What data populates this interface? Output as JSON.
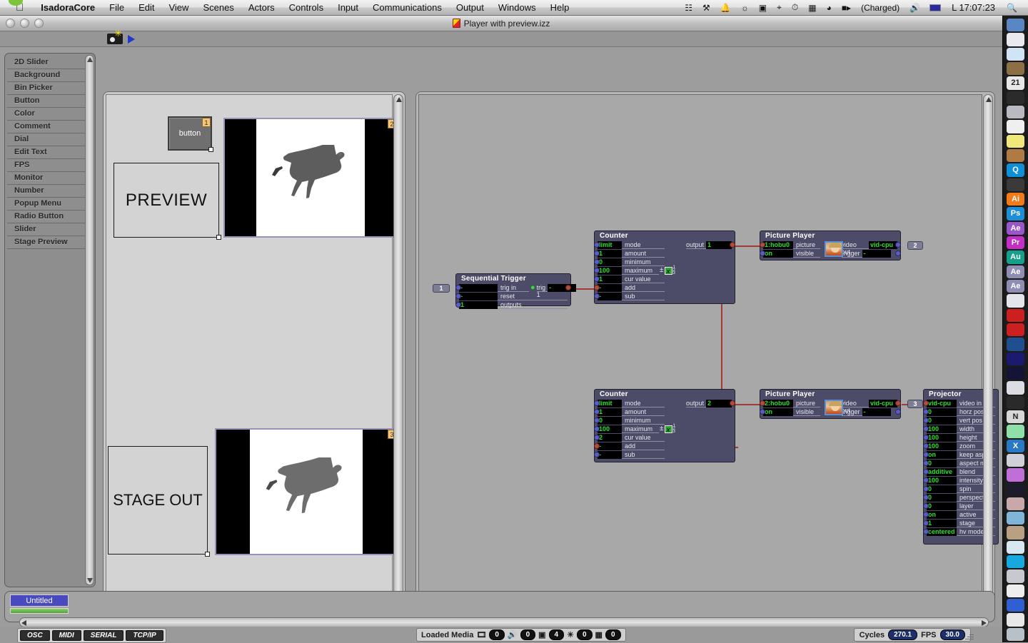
{
  "menubar": {
    "app_name": "IsadoraCore",
    "items": [
      "File",
      "Edit",
      "View",
      "Scenes",
      "Actors",
      "Controls",
      "Input",
      "Communications",
      "Output",
      "Windows",
      "Help"
    ],
    "status_icons": [
      "grid-icon",
      "ink-icon",
      "bell-icon",
      "keyboard-brightness-icon",
      "display-icon",
      "bluetooth-icon",
      "timemachine-icon",
      "screensharing-icon",
      "wifi-icon"
    ],
    "battery_label": "(Charged)",
    "volume_icon": "speaker-icon",
    "input_flag": "keyboard-flag",
    "clock": "L 17:07:23",
    "search_icon": "search-icon"
  },
  "window": {
    "title": "Player with preview.izz",
    "doc_icon": "izz-document-icon",
    "toolbar": {
      "snapshot_icon": "camera-snapshot-icon",
      "run_icon": "play-triangle-icon"
    }
  },
  "tool_list": {
    "items": [
      "2D Slider",
      "Background",
      "Bin Picker",
      "Button",
      "Color",
      "Comment",
      "Dial",
      "Edit Text",
      "FPS",
      "Monitor",
      "Number",
      "Popup Menu",
      "Radio Button",
      "Slider",
      "Stage Preview"
    ]
  },
  "control_panel": {
    "button_widget": {
      "label": "button",
      "index": "1"
    },
    "preview_text": "PREVIEW",
    "stage_out_text": "STAGE OUT",
    "preview_stage": {
      "index": "2"
    },
    "output_stage": {
      "index": "3"
    }
  },
  "scene_editor": {
    "actors": [
      {
        "name": "Sequential Trigger",
        "input_badge": "1",
        "inputs": [
          {
            "value": "-",
            "label": "trig in"
          },
          {
            "value": "-",
            "label": "reset"
          },
          {
            "value": "1",
            "label": "outputs"
          }
        ],
        "outputs": [
          {
            "label": "trig 1",
            "value": "-",
            "led": "green-led-icon"
          }
        ]
      },
      {
        "name": "Counter",
        "id": "counter-top",
        "inputs": [
          {
            "value": "limit",
            "label": "mode"
          },
          {
            "value": "1",
            "label": "amount"
          },
          {
            "value": "0",
            "label": "minimum"
          },
          {
            "value": "100",
            "label": "maximum"
          },
          {
            "value": "1",
            "label": "cur value"
          },
          {
            "value": "-",
            "label": "add"
          },
          {
            "value": "-",
            "label": "sub"
          }
        ],
        "outputs": [
          {
            "label": "output",
            "value": "1"
          }
        ],
        "widgets": [
          "plus-minus-icon",
          "x-expression-icon",
          "stack-123-icon"
        ]
      },
      {
        "name": "Picture Player",
        "id": "picture-player-top",
        "inputs": [
          {
            "value": "1:hobu0",
            "label": "picture"
          },
          {
            "value": "on",
            "label": "visible"
          }
        ],
        "outputs": [
          {
            "label": "video out",
            "value": "vid-cpu"
          },
          {
            "label": "trigger",
            "value": "-"
          }
        ],
        "thumbnail": "portrait-thumbnail-icon",
        "out_badge": "2"
      },
      {
        "name": "Counter",
        "id": "counter-bottom",
        "inputs": [
          {
            "value": "limit",
            "label": "mode"
          },
          {
            "value": "1",
            "label": "amount"
          },
          {
            "value": "0",
            "label": "minimum"
          },
          {
            "value": "100",
            "label": "maximum"
          },
          {
            "value": "2",
            "label": "cur value"
          },
          {
            "value": "-",
            "label": "add"
          },
          {
            "value": "-",
            "label": "sub"
          }
        ],
        "outputs": [
          {
            "label": "output",
            "value": "2"
          }
        ],
        "widgets": [
          "plus-minus-icon",
          "x-expression-icon",
          "stack-123-icon"
        ]
      },
      {
        "name": "Picture Player",
        "id": "picture-player-bottom",
        "inputs": [
          {
            "value": "2:hobu0",
            "label": "picture"
          },
          {
            "value": "on",
            "label": "visible"
          }
        ],
        "outputs": [
          {
            "label": "video out",
            "value": "vid-cpu"
          },
          {
            "label": "trigger",
            "value": "-"
          }
        ],
        "thumbnail": "portrait-thumbnail-icon",
        "out_badge": "3"
      },
      {
        "name": "Projector",
        "id": "projector",
        "inputs": [
          {
            "value": "vid-cpu",
            "label": "video in"
          },
          {
            "value": "0",
            "label": "horz pos"
          },
          {
            "value": "0",
            "label": "vert pos"
          },
          {
            "value": "100",
            "label": "width"
          },
          {
            "value": "100",
            "label": "height"
          },
          {
            "value": "100",
            "label": "zoom"
          },
          {
            "value": "on",
            "label": "keep aspe"
          },
          {
            "value": "0",
            "label": "aspect mo"
          },
          {
            "value": "additive",
            "label": "blend"
          },
          {
            "value": "100",
            "label": "intensity"
          },
          {
            "value": "0",
            "label": "spin"
          },
          {
            "value": "0",
            "label": "perspectiv"
          },
          {
            "value": "0",
            "label": "layer"
          },
          {
            "value": "on",
            "label": "active"
          },
          {
            "value": "1",
            "label": "stage"
          },
          {
            "value": "centered",
            "label": "hv mode"
          }
        ],
        "outputs": []
      }
    ]
  },
  "scene_strip": {
    "scene_name": "Untitled"
  },
  "status_bar": {
    "protocols": [
      "OSC",
      "MIDI",
      "SERIAL",
      "TCP/IP"
    ],
    "loaded_media_label": "Loaded Media",
    "media_counts": [
      {
        "icon": "film-icon",
        "value": "0"
      },
      {
        "icon": "speaker-icon",
        "value": "0"
      },
      {
        "icon": "picture-icon",
        "value": "4"
      },
      {
        "icon": "globe-icon",
        "value": "0"
      },
      {
        "icon": "cube-icon",
        "value": "0"
      }
    ],
    "cycles_label": "Cycles",
    "cycles_value": "270.1",
    "fps_label": "FPS",
    "fps_value": "30.0"
  },
  "dock": {
    "items": [
      {
        "name": "finder-icon",
        "text": "",
        "bg": "#5a86c4"
      },
      {
        "name": "mail-icon",
        "text": "",
        "bg": "#e9e9ef"
      },
      {
        "name": "safari-icon",
        "text": "",
        "bg": "#cfe4f5"
      },
      {
        "name": "squirrel-app-icon",
        "text": "",
        "bg": "#8d6f46"
      },
      {
        "name": "ical-icon",
        "text": "21",
        "bg": "#e8e8e8"
      },
      {
        "name": "compass-icon",
        "text": "",
        "bg": "#2b2b2b"
      },
      {
        "name": "dvd-player-icon",
        "text": "",
        "bg": "#b9b9c2"
      },
      {
        "name": "textedit-icon",
        "text": "",
        "bg": "#efefef"
      },
      {
        "name": "stickies-icon",
        "text": "",
        "bg": "#f0e87a"
      },
      {
        "name": "mailbox-icon",
        "text": "",
        "bg": "#b07a44"
      },
      {
        "name": "sherlock-icon",
        "text": "Q",
        "bg": "#0e8fd8"
      },
      {
        "name": "toolbench-icon",
        "text": "",
        "bg": "#3a3a3a"
      },
      {
        "name": "adobe-illustrator-icon",
        "text": "Ai",
        "bg": "#f07b18"
      },
      {
        "name": "adobe-photoshop-icon",
        "text": "Ps",
        "bg": "#1d8ed6"
      },
      {
        "name": "adobe-aftereffects-icon",
        "text": "Ae",
        "bg": "#9a56c9"
      },
      {
        "name": "adobe-premiere-icon",
        "text": "Pr",
        "bg": "#c32ec4"
      },
      {
        "name": "adobe-audition-icon",
        "text": "Au",
        "bg": "#16a08c"
      },
      {
        "name": "adobe-aftereffects-alt-icon",
        "text": "Ae",
        "bg": "#8e8eb4"
      },
      {
        "name": "adobe-aftereffects-alt2-icon",
        "text": "Ae",
        "bg": "#8e8eb4"
      },
      {
        "name": "sketch-tool-icon",
        "text": "",
        "bg": "#e4e4ec"
      },
      {
        "name": "isadora-icon",
        "text": "",
        "bg": "#cc1f1f"
      },
      {
        "name": "isadora-core-icon",
        "text": "",
        "bg": "#cc1f1f"
      },
      {
        "name": "vdmx-icon",
        "text": "",
        "bg": "#1f4f8f"
      },
      {
        "name": "quartz-icon",
        "text": "",
        "bg": "#1a1a6e"
      },
      {
        "name": "max-msp-icon",
        "text": "",
        "bg": "#141436"
      },
      {
        "name": "disk-utility-icon",
        "text": "",
        "bg": "#dcdce4"
      },
      {
        "name": "cable-icon",
        "text": "",
        "bg": "#2a2a2a"
      },
      {
        "name": "neo-office-icon",
        "text": "N",
        "bg": "#d8d8d8"
      },
      {
        "name": "spreadsheet-icon",
        "text": "",
        "bg": "#8fe0a8"
      },
      {
        "name": "xcode-icon",
        "text": "X",
        "bg": "#2b79c4"
      },
      {
        "name": "imageviewer-icon",
        "text": "",
        "bg": "#d0d0d8"
      },
      {
        "name": "tape-icon",
        "text": "",
        "bg": "#c06fd8"
      },
      {
        "name": "quickmedia-icon",
        "text": "",
        "bg": "#1b1b2c"
      },
      {
        "name": "photo-tool-icon",
        "text": "",
        "bg": "#c8a8a8"
      },
      {
        "name": "colorwindow-icon",
        "text": "",
        "bg": "#7fb6d8"
      },
      {
        "name": "hands-icon",
        "text": "",
        "bg": "#b8a080"
      },
      {
        "name": "cd-icon",
        "text": "",
        "bg": "#d8e8f0"
      },
      {
        "name": "skype-icon",
        "text": "",
        "bg": "#17a8e0"
      },
      {
        "name": "scanner-icon",
        "text": "",
        "bg": "#c8c8d0"
      },
      {
        "name": "piano-icon",
        "text": "",
        "bg": "#eeeeee"
      },
      {
        "name": "blue-bar-icon",
        "text": "",
        "bg": "#2f5fd0"
      },
      {
        "name": "activity-monitor-icon",
        "text": "",
        "bg": "#e8e8e8"
      },
      {
        "name": "trash-icon",
        "text": "",
        "bg": "#b8c0c8"
      }
    ]
  }
}
